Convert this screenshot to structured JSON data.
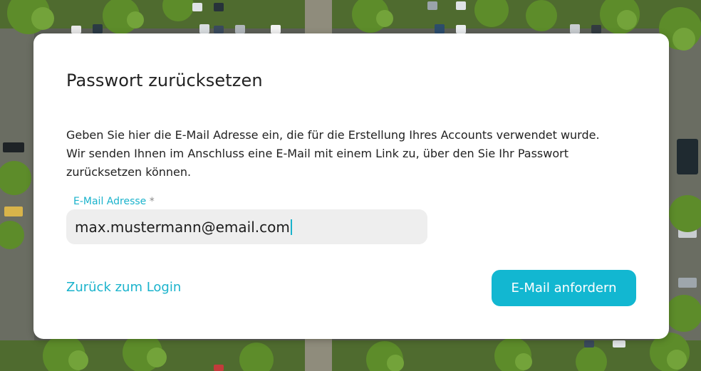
{
  "form": {
    "title": "Passwort zurücksetzen",
    "description": "Geben Sie hier die E-Mail Adresse ein, die für die Erstellung Ihres Accounts verwendet wurde. Wir senden Ihnen im Anschluss eine E-Mail mit einem Link zu, über den Sie Ihr Passwort zurücksetzen können.",
    "email_label": "E-Mail Adresse",
    "required_marker": "*",
    "email_value": "max.mustermann@email.com",
    "back_link_label": "Zurück zum Login",
    "submit_label": "E-Mail anfordern"
  },
  "colors": {
    "accent": "#12b7d1",
    "label": "#1ab3cc",
    "card": "#ffffff",
    "input_bg": "#eeeeee",
    "text": "#222222"
  }
}
